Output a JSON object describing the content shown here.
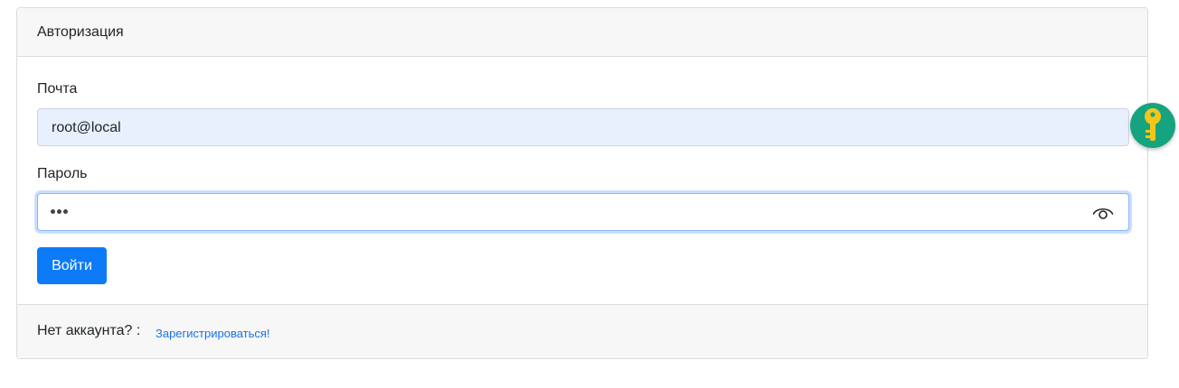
{
  "header": {
    "title": "Авторизация"
  },
  "form": {
    "email": {
      "label": "Почта",
      "value": "root@local"
    },
    "password": {
      "label": "Пароль",
      "masked_value": "•••"
    },
    "submit_label": "Войти"
  },
  "footer": {
    "prompt": "Нет аккаунта? :",
    "register_link": "Зарегистрироваться!"
  },
  "icons": {
    "password_toggle": "eye-icon",
    "password_manager": "key-icon"
  },
  "colors": {
    "primary": "#0d7bf7",
    "link": "#1a73e8",
    "autofill_bg": "#e8f0fe",
    "badge": "#16a37f",
    "key": "#f5c518"
  }
}
